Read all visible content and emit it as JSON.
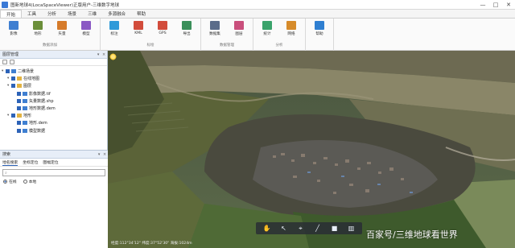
{
  "window": {
    "title": "图新地球4(LocaSpaceViewer)正版用户-三维数字地球",
    "controls": [
      "—",
      "□",
      "✕"
    ]
  },
  "menu": {
    "items": [
      "开始",
      "工具",
      "分析",
      "场景",
      "三维",
      "多源融合",
      "帮助"
    ],
    "active_index": 0
  },
  "ribbon": {
    "groups": [
      {
        "label": "数据添加",
        "tools": [
          {
            "label": "影像",
            "icon": "image-icon",
            "color": "#3f7fd1"
          },
          {
            "label": "地形",
            "icon": "terrain-icon",
            "color": "#6b8f3a"
          },
          {
            "label": "矢量",
            "icon": "vector-icon",
            "color": "#d67b2a"
          },
          {
            "label": "模型",
            "icon": "model-icon",
            "color": "#8a58c4"
          }
        ]
      },
      {
        "label": "标绘",
        "tools": [
          {
            "label": "标注",
            "icon": "pin-icon",
            "color": "#2f9ad9"
          },
          {
            "label": "KML",
            "icon": "kml-icon",
            "color": "#d24c3b"
          },
          {
            "label": "GPS",
            "icon": "gps-icon",
            "color": "#d24c3b"
          },
          {
            "label": "导出",
            "icon": "export-icon",
            "color": "#3a8f5a"
          }
        ]
      },
      {
        "label": "数据管理",
        "tools": [
          {
            "label": "数据集",
            "icon": "dataset-icon",
            "color": "#5a6c8a"
          },
          {
            "label": "图层",
            "icon": "layer-icon",
            "color": "#c94f7c"
          }
        ]
      },
      {
        "label": "分析",
        "tools": [
          {
            "label": "统计",
            "icon": "stats-icon",
            "color": "#3aa36b"
          },
          {
            "label": "网络",
            "icon": "network-icon",
            "color": "#d68b2a"
          }
        ]
      },
      {
        "label": "",
        "tools": [
          {
            "label": "帮助",
            "icon": "help-icon",
            "color": "#2f7fd1"
          }
        ]
      }
    ]
  },
  "layers_panel": {
    "title": "图层管理",
    "items": [
      {
        "label": "二维场景",
        "depth": 0,
        "icon": "globe-icon",
        "color": "#3f7fd1"
      },
      {
        "label": "在线地图",
        "depth": 1,
        "icon": "folder-icon",
        "color": "#e3b341"
      },
      {
        "label": "图层",
        "depth": 1,
        "icon": "folder-icon",
        "color": "#e3b341"
      },
      {
        "label": "影像数据.tif",
        "depth": 2,
        "icon": "image-icon",
        "color": "#3f7fd1"
      },
      {
        "label": "矢量数据.shp",
        "depth": 2,
        "icon": "vector-icon",
        "color": "#3f7fd1"
      },
      {
        "label": "地形数据.dem",
        "depth": 2,
        "icon": "terrain-icon",
        "color": "#3f7fd1"
      },
      {
        "label": "地形",
        "depth": 1,
        "icon": "folder-icon",
        "color": "#e3b341"
      },
      {
        "label": "地形.dem",
        "depth": 2,
        "icon": "terrain-icon",
        "color": "#3f7fd1"
      },
      {
        "label": "模型数据",
        "depth": 2,
        "icon": "model-icon",
        "color": "#3f7fd1"
      }
    ]
  },
  "search_panel": {
    "title": "搜索",
    "tabs": [
      "地名搜索",
      "坐标定位",
      "图幅定位"
    ],
    "active_tab": 0,
    "radios": [
      {
        "label": "在线",
        "checked": true
      },
      {
        "label": "本地"
      }
    ]
  },
  "map": {
    "coordinates_text": "经度:112°34'12\" 纬度:37°52'30\" 海拔:1024m",
    "toolbar": [
      {
        "name": "pan-tool",
        "glyph": "✋"
      },
      {
        "name": "select-tool",
        "glyph": "↖"
      },
      {
        "name": "point-tool",
        "glyph": "⌖"
      },
      {
        "name": "line-tool",
        "glyph": "╱"
      },
      {
        "name": "polygon-tool",
        "glyph": "■"
      },
      {
        "name": "measure-tool",
        "glyph": "▥"
      }
    ]
  },
  "watermark": "百家号/三维地球看世界"
}
